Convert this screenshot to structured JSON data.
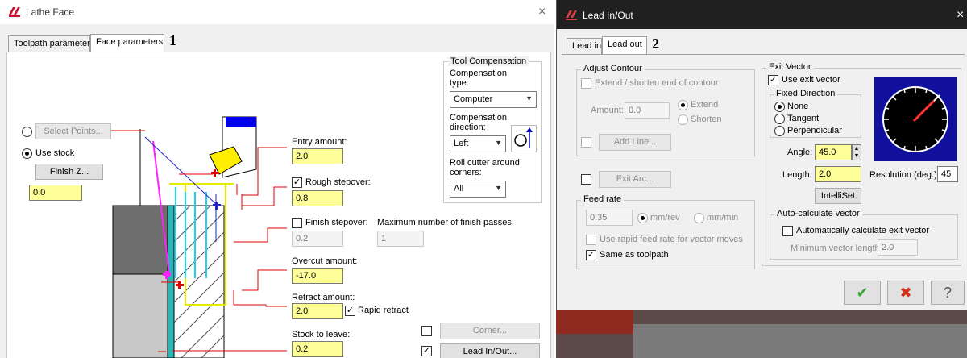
{
  "lathe_face": {
    "title": "Lathe Face",
    "close_glyph": "×",
    "callout": "1",
    "tabs": [
      "Toolpath parameters",
      "Face parameters"
    ],
    "select_points_label": "Select Points...",
    "use_stock_label": "Use stock",
    "finish_z_label": "Finish Z...",
    "finish_z_value": "0.0",
    "entry_amount_label": "Entry amount:",
    "entry_amount_value": "2.0",
    "rough_stepover_label": "Rough stepover:",
    "rough_stepover_value": "0.8",
    "rough_stepover_checked": "✓",
    "finish_stepover_label": "Finish stepover:",
    "finish_stepover_value": "0.2",
    "max_finish_passes_label": "Maximum number of finish passes:",
    "max_finish_passes_value": "1",
    "overcut_label": "Overcut amount:",
    "overcut_value": "-17.0",
    "retract_label": "Retract amount:",
    "retract_value": "2.0",
    "rapid_retract_label": "Rapid retract",
    "rapid_retract_checked": "✓",
    "stock_to_leave_label": "Stock to leave:",
    "stock_to_leave_value": "0.2",
    "tool_compensation": {
      "group_title": "Tool Compensation",
      "comp_type_label": "Compensation type:",
      "comp_type_value": "Computer",
      "comp_direction_label": "Compensation direction:",
      "comp_direction_value": "Left",
      "roll_cutter_label": "Roll cutter around corners:",
      "roll_cutter_value": "All"
    },
    "corner_label": "Corner...",
    "lead_in_out_label": "Lead In/Out...",
    "lead_in_out_checked": "✓"
  },
  "lead_in_out": {
    "title": "Lead In/Out",
    "close_glyph": "×",
    "callout": "2",
    "tabs": [
      "Lead in",
      "Lead out"
    ],
    "adjust_contour": {
      "group_title": "Adjust Contour",
      "extend_shorten_label": "Extend / shorten end of contour",
      "amount_label": "Amount:",
      "amount_value": "0.0",
      "extend_label": "Extend",
      "shorten_label": "Shorten",
      "add_line_label": "Add Line..."
    },
    "exit_arc_label": "Exit Arc...",
    "feed_rate": {
      "group_title": "Feed rate",
      "value": "0.35",
      "mm_rev_label": "mm/rev",
      "mm_min_label": "mm/min",
      "use_rapid_label": "Use rapid feed rate for vector moves",
      "same_as_toolpath_label": "Same as toolpath",
      "same_as_toolpath_checked": "✓"
    },
    "exit_vector": {
      "group_title": "Exit Vector",
      "use_exit_vector_label": "Use exit vector",
      "use_exit_vector_checked": "✓",
      "fixed_direction_title": "Fixed Direction",
      "none_label": "None",
      "tangent_label": "Tangent",
      "perpendicular_label": "Perpendicular",
      "angle_label": "Angle:",
      "angle_value": "45.0",
      "length_label": "Length:",
      "length_value": "2.0",
      "resolution_label": "Resolution (deg.):",
      "resolution_value": "45",
      "intelliset_label": "IntelliSet"
    },
    "auto_calc": {
      "group_title": "Auto-calculate vector",
      "auto_calc_label": "Automatically calculate exit vector",
      "min_length_label": "Minimum vector length:",
      "min_length_value": "2.0"
    },
    "ok_glyph": "✔",
    "cancel_glyph": "✖",
    "help_glyph": "?"
  },
  "colors": {
    "input_yellow": "#ffff99",
    "ok_green": "#3aa530",
    "cancel_red": "#d32f1c",
    "dial_blue": "#10109c",
    "diagram_red": "#e00000",
    "diagram_blue": "#2020d0",
    "diagram_cyan": "#20d0f0",
    "diagram_magenta": "#ff20ff"
  }
}
